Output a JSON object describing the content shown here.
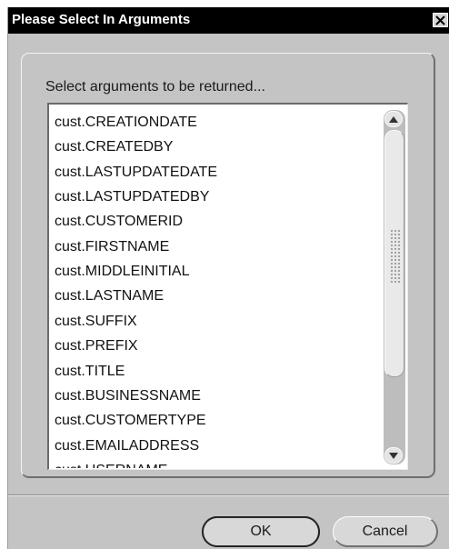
{
  "window": {
    "title": "Please Select In Arguments",
    "close_icon": "close-icon"
  },
  "prompt": "Select arguments to be returned...",
  "arguments": [
    "cust.CREATIONDATE",
    "cust.CREATEDBY",
    "cust.LASTUPDATEDATE",
    "cust.LASTUPDATEDBY",
    "cust.CUSTOMERID",
    "cust.FIRSTNAME",
    "cust.MIDDLEINITIAL",
    "cust.LASTNAME",
    "cust.SUFFIX",
    "cust.PREFIX",
    "cust.TITLE",
    "cust.BUSINESSNAME",
    "cust.CUSTOMERTYPE",
    "cust.EMAILADDRESS",
    "cust.USERNAME"
  ],
  "scrollbar": {
    "up_icon": "arrow-up-icon",
    "down_icon": "arrow-down-icon"
  },
  "buttons": {
    "ok": "OK",
    "cancel": "Cancel"
  }
}
